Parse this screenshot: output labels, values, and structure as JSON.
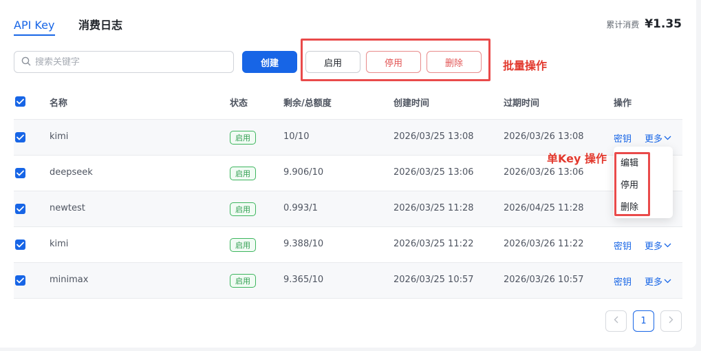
{
  "tabs": [
    {
      "label": "API Key",
      "active": true
    },
    {
      "label": "消费日志",
      "active": false
    }
  ],
  "summary": {
    "label": "累计消费",
    "value": "¥1.35"
  },
  "search": {
    "placeholder": "搜索关键字",
    "value": ""
  },
  "toolbar": {
    "create": "创建",
    "enable": "启用",
    "disable": "停用",
    "delete": "删除"
  },
  "annotations": {
    "batch": "批量操作",
    "single": "单Key 操作"
  },
  "table": {
    "headers": [
      "名称",
      "状态",
      "剩余/总额度",
      "创建时间",
      "过期时间",
      "操作"
    ],
    "rows": [
      {
        "name": "kimi",
        "status": "启用",
        "quota": "10/10",
        "created": "2026/03/25 13:08",
        "expires": "2026/03/26 13:08",
        "key_link": "密钥",
        "more_link": "更多"
      },
      {
        "name": "deepseek",
        "status": "启用",
        "quota": "9.906/10",
        "created": "2026/03/25 13:06",
        "expires": "2026/03/26 13:06",
        "key_link": "",
        "more_link": ""
      },
      {
        "name": "newtest",
        "status": "启用",
        "quota": "0.993/1",
        "created": "2026/03/25 11:28",
        "expires": "2026/04/25 11:28",
        "key_link": "",
        "more_link": ""
      },
      {
        "name": "kimi",
        "status": "启用",
        "quota": "9.388/10",
        "created": "2026/03/25 11:22",
        "expires": "2026/03/26 11:22",
        "key_link": "密钥",
        "more_link": "更多"
      },
      {
        "name": "minimax",
        "status": "启用",
        "quota": "9.365/10",
        "created": "2026/03/25 10:57",
        "expires": "2026/03/26 10:57",
        "key_link": "密钥",
        "more_link": "更多"
      }
    ]
  },
  "dropdown": {
    "items": [
      "编辑",
      "停用",
      "删除"
    ]
  },
  "pagination": {
    "current": "1"
  },
  "colors": {
    "primary": "#1765e6",
    "danger": "#e25555",
    "success": "#2f9e4f",
    "annotation": "#e2392e"
  }
}
